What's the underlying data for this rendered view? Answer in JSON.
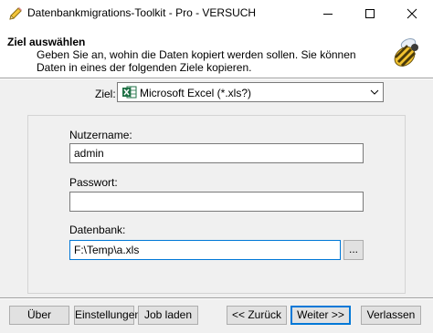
{
  "window": {
    "title": "Datenbankmigrations-Toolkit - Pro - VERSUCH",
    "app_icon": "pencil-icon",
    "controls": [
      "minimize-icon",
      "maximize-icon",
      "close-icon"
    ]
  },
  "header": {
    "title": "Ziel auswählen",
    "description": "Geben Sie an, wohin die Daten kopiert werden sollen. Sie können Daten in eines der folgenden Ziele kopieren.",
    "icon": "bee-icon"
  },
  "target": {
    "label": "Ziel:",
    "selected": "Microsoft Excel (*.xls?)",
    "icon": "excel-icon"
  },
  "form": {
    "username_label": "Nutzername:",
    "username_value": "admin",
    "password_label": "Passwort:",
    "password_value": "",
    "database_label": "Datenbank:",
    "database_value": "F:\\Temp\\a.xls",
    "browse_label": "..."
  },
  "buttons": {
    "about": "Über",
    "settings": "Einstellungen",
    "load_job": "Job laden",
    "back": "<< Zurück",
    "next": "Weiter >>",
    "exit": "Verlassen"
  },
  "colors": {
    "focus_border": "#0078d7",
    "excel_green": "#1e7145"
  }
}
